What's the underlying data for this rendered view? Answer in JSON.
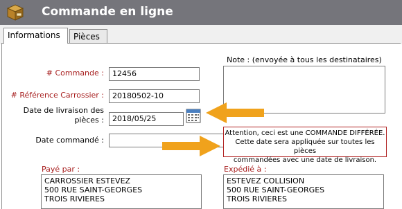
{
  "window": {
    "title": "Commande en ligne"
  },
  "tabs": [
    {
      "label": "Informations",
      "active": true
    },
    {
      "label": "Pièces",
      "active": false
    }
  ],
  "form": {
    "commande_label": "# Commande :",
    "commande_value": "12456",
    "reference_label": "# Référence Carrossier :",
    "reference_value": "20180502-10",
    "date_livraison_label_line1": "Date de livraison des",
    "date_livraison_label_line2": "pièces :",
    "date_livraison_value": "2018/05/25",
    "date_commande_label": "Date commandé :",
    "date_commande_value": ""
  },
  "note": {
    "label": "Note : (envoyée à tous les destinataires)",
    "value": ""
  },
  "warning": {
    "line1": "Attention, ceci est une COMMANDE DIFFÉRÉE.",
    "line2": "Cette date sera appliquée sur toutes les pièces",
    "line3": "commandées avec une date de livraison."
  },
  "paye_par": {
    "label": "Payé par :",
    "lines": [
      "CARROSSIER ESTEVEZ",
      "500 RUE SAINT-GEORGES",
      "TROIS RIVIERES"
    ]
  },
  "expedie_a": {
    "label": "Expédié à :",
    "lines": [
      "ESTEVEZ COLLISION",
      "500 RUE SAINT-GEORGES",
      "TROIS RIVIERES"
    ]
  },
  "colors": {
    "titlebar": "#75757b",
    "required_label": "#a61c1c",
    "arrow": "#f0a21c",
    "warning_border": "#b02020"
  },
  "icons": {
    "app": "package-icon",
    "calendar": "calendar-icon",
    "arrow": "arrow-icon"
  }
}
